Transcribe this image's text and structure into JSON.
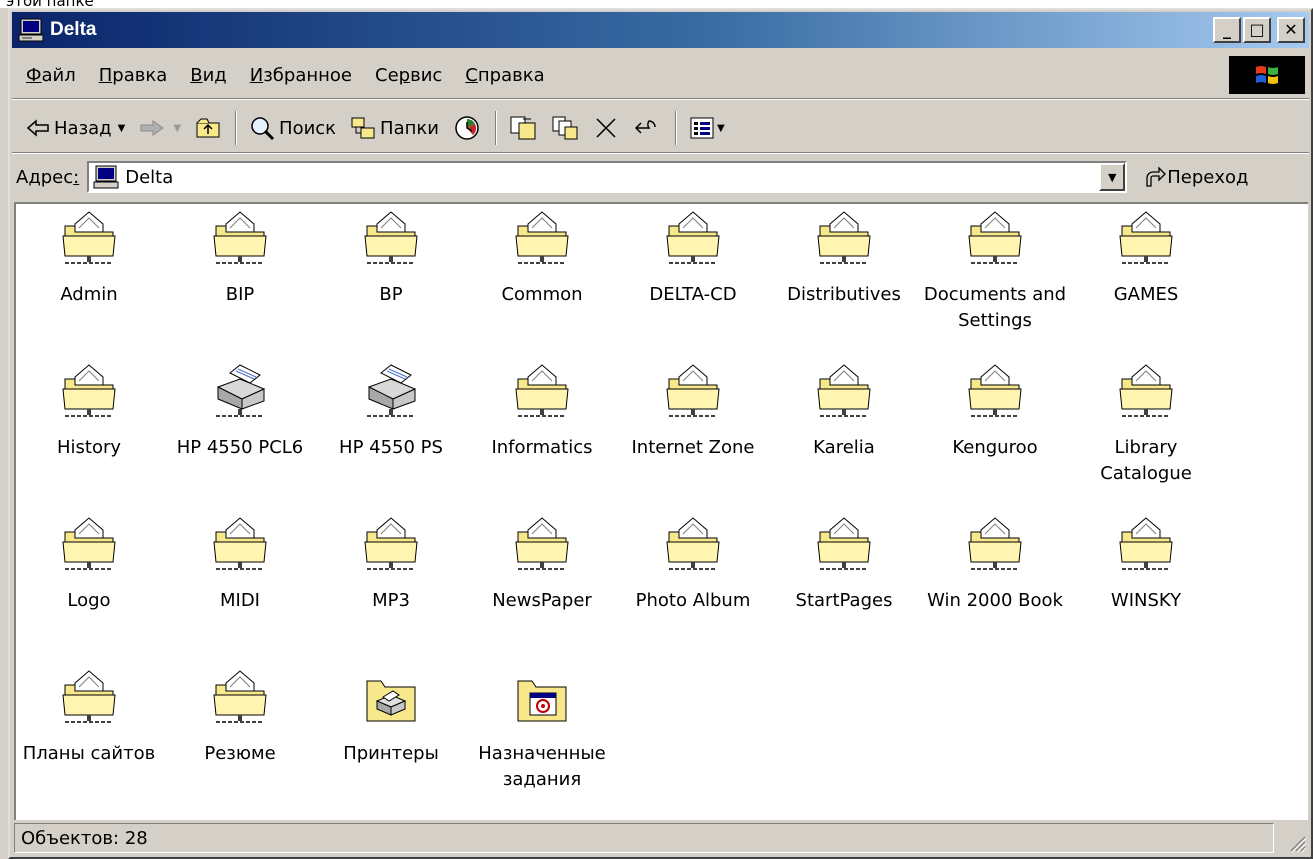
{
  "background_fragment": "этой папке",
  "window": {
    "title": "Delta",
    "minimize_label": "_",
    "maximize_label": "□",
    "close_label": "✕"
  },
  "menu": [
    {
      "label": "Файл",
      "accel": "Ф",
      "rest": "айл"
    },
    {
      "label": "Правка",
      "accel": "П",
      "rest": "равка"
    },
    {
      "label": "Вид",
      "accel": "В",
      "rest": "ид"
    },
    {
      "label": "Избранное",
      "accel": "И",
      "rest": "збранное"
    },
    {
      "pre": "Се",
      "accel": "р",
      "rest": "вис"
    },
    {
      "label": "Справка",
      "accel": "С",
      "rest": "правка"
    }
  ],
  "toolbar": {
    "back_label": "Назад",
    "search_label": "Поиск",
    "folders_label": "Папки"
  },
  "address": {
    "label_pre": "Адрес",
    "label_accel": ":",
    "value": "Delta",
    "go_label": "Переход"
  },
  "items": [
    {
      "name": "Admin",
      "icon": "shared-folder-icon"
    },
    {
      "name": "BIP",
      "icon": "shared-folder-icon"
    },
    {
      "name": "BP",
      "icon": "shared-folder-icon"
    },
    {
      "name": "Common",
      "icon": "shared-folder-icon"
    },
    {
      "name": "DELTA-CD",
      "icon": "shared-folder-icon"
    },
    {
      "name": "Distributives",
      "icon": "shared-folder-icon"
    },
    {
      "name": "Documents and Settings",
      "icon": "shared-folder-icon"
    },
    {
      "name": "GAMES",
      "icon": "shared-folder-icon"
    },
    {
      "name": "History",
      "icon": "shared-folder-icon"
    },
    {
      "name": "HP 4550 PCL6",
      "icon": "network-printer-icon"
    },
    {
      "name": "HP 4550 PS",
      "icon": "network-printer-icon"
    },
    {
      "name": "Informatics",
      "icon": "shared-folder-icon"
    },
    {
      "name": "Internet Zone",
      "icon": "shared-folder-icon"
    },
    {
      "name": "Karelia",
      "icon": "shared-folder-icon"
    },
    {
      "name": "Kenguroo",
      "icon": "shared-folder-icon"
    },
    {
      "name": "Library Catalogue",
      "icon": "shared-folder-icon"
    },
    {
      "name": "Logo",
      "icon": "shared-folder-icon"
    },
    {
      "name": "MIDI",
      "icon": "shared-folder-icon"
    },
    {
      "name": "MP3",
      "icon": "shared-folder-icon"
    },
    {
      "name": "NewsPaper",
      "icon": "shared-folder-icon"
    },
    {
      "name": "Photo Album",
      "icon": "shared-folder-icon"
    },
    {
      "name": "StartPages",
      "icon": "shared-folder-icon"
    },
    {
      "name": "Win 2000 Book",
      "icon": "shared-folder-icon"
    },
    {
      "name": "WINSKY",
      "icon": "shared-folder-icon"
    },
    {
      "name": "Планы сайтов",
      "icon": "shared-folder-icon"
    },
    {
      "name": "Резюме",
      "icon": "shared-folder-icon"
    },
    {
      "name": "Принтеры",
      "icon": "printers-folder-icon"
    },
    {
      "name": "Назначенные задания",
      "icon": "scheduled-tasks-folder-icon"
    }
  ],
  "status": {
    "text": "Объектов: 28"
  },
  "colors": {
    "title_start": "#0a246a",
    "title_end": "#a6caf0",
    "chrome": "#d4d0c8",
    "folder": "#f8e88c"
  }
}
